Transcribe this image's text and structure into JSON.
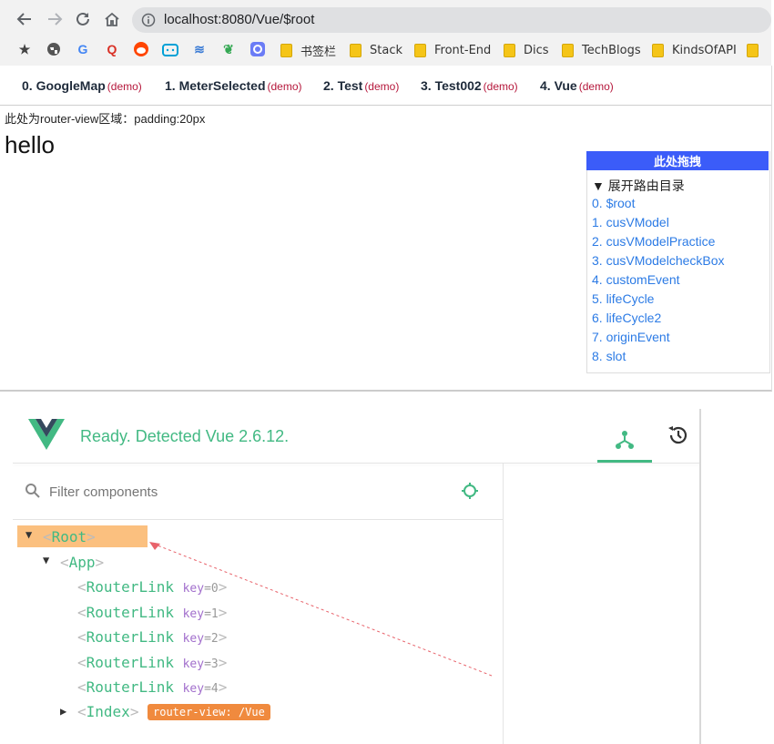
{
  "browser": {
    "url": "localhost:8080/Vue/$root",
    "icons": [
      "back-icon",
      "forward-icon",
      "reload-icon",
      "home-icon",
      "info-icon",
      "star-icon"
    ],
    "bookmark_folders": [
      "书签栏",
      "Stack",
      "Front-End",
      "Dics",
      "TechBlogs",
      "KindsOfAPI"
    ]
  },
  "nav": {
    "tabs": [
      {
        "label": "0. GoogleMap",
        "demo": "(demo)"
      },
      {
        "label": "1. MeterSelected",
        "demo": "(demo)"
      },
      {
        "label": "2. Test",
        "demo": "(demo)"
      },
      {
        "label": "3. Test002",
        "demo": "(demo)"
      },
      {
        "label": "4. Vue",
        "demo": "(demo)"
      }
    ]
  },
  "page": {
    "router_note": "此处为router-view区域：padding:20px",
    "hello": "hello"
  },
  "route_panel": {
    "drag_label": "此处拖拽",
    "summary": "▼ 展开路由目录",
    "routes": [
      "0. $root",
      "1. cusVModel",
      "2. cusVModelPractice",
      "3. cusVModelcheckBox",
      "4. customEvent",
      "5. lifeCycle",
      "6. lifeCycle2",
      "7. originEvent",
      "8. slot"
    ]
  },
  "devtools": {
    "status": "Ready. Detected Vue 2.6.12.",
    "filter_placeholder": "Filter components",
    "tree": {
      "root": "Root",
      "app": "App",
      "router_links": [
        {
          "name": "RouterLink",
          "key": "key",
          "value": "0"
        },
        {
          "name": "RouterLink",
          "key": "key",
          "value": "1"
        },
        {
          "name": "RouterLink",
          "key": "key",
          "value": "2"
        },
        {
          "name": "RouterLink",
          "key": "key",
          "value": "3"
        },
        {
          "name": "RouterLink",
          "key": "key",
          "value": "4"
        }
      ],
      "index": "Index",
      "index_badge": "router-view: /Vue"
    },
    "colors": {
      "vue_green": "#42b983",
      "selected_bg": "#fbc07f",
      "badge": "#f08a3e",
      "arrow": "#e8636b"
    }
  }
}
